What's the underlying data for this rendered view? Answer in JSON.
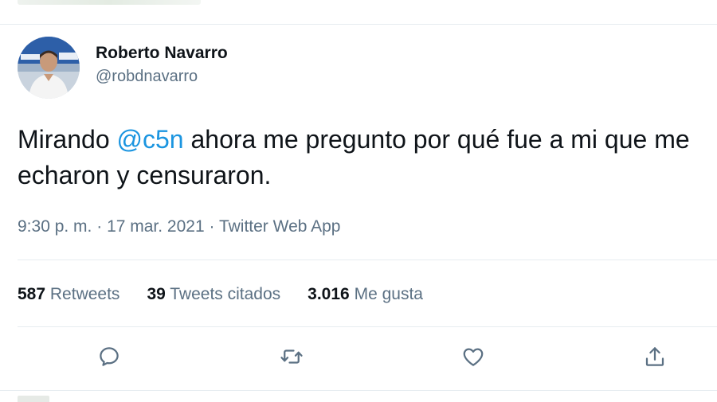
{
  "tweet": {
    "author": {
      "display_name": "Roberto Navarro",
      "handle": "@robdnavarro"
    },
    "text": {
      "before_mention": "Mirando ",
      "mention": "@c5n",
      "after_mention": " ahora me pregunto por qué fue a mi que me echaron y censuraron."
    },
    "meta": {
      "time": "9:30 p. m.",
      "separator_1": " · ",
      "date": "17 mar. 2021",
      "separator_2": " · ",
      "source": "Twitter Web App"
    },
    "stats": [
      {
        "count": "587",
        "label": "Retweets"
      },
      {
        "count": "39",
        "label": "Tweets citados"
      },
      {
        "count": "3.016",
        "label": "Me gusta"
      }
    ],
    "actions": [
      {
        "icon": "reply-icon"
      },
      {
        "icon": "retweet-icon"
      },
      {
        "icon": "like-icon"
      },
      {
        "icon": "share-icon"
      }
    ]
  },
  "colors": {
    "text": "#0f1419",
    "secondary": "#5b7083",
    "link": "#1b95e0",
    "divider": "#e6ecf0"
  }
}
